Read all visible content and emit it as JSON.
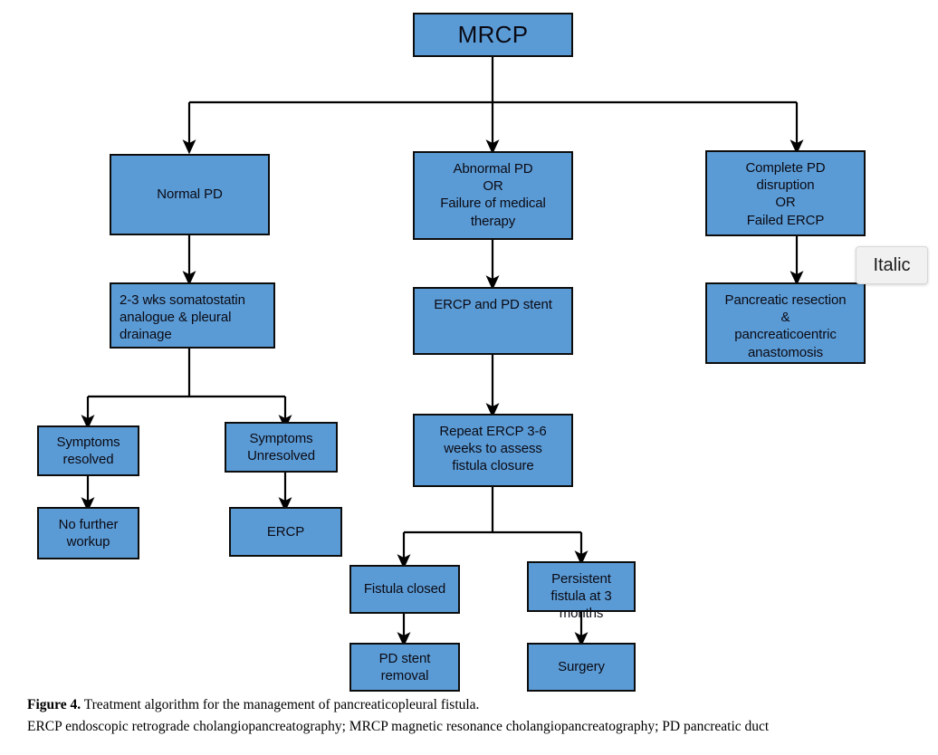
{
  "figure": {
    "caption_bold": "Figure 4.",
    "caption_rest": " Treatment algorithm for the management of pancreaticopleural fistula.",
    "abbreviations": "ERCP endoscopic retrograde cholangiopancreatography; MRCP magnetic resonance cholangiopancreatography; PD pancreatic duct"
  },
  "tooltip": {
    "label": "Italic"
  },
  "colors": {
    "node_fill": "#5B9BD5",
    "node_border": "#0d0d0d",
    "connector": "#000000",
    "tooltip_bg": "#f1f1f1",
    "page_bg": "#ffffff"
  },
  "nodes": {
    "root": "MRCP",
    "normal_pd": "Normal PD",
    "abnormal_pd": "Abnormal PD\nOR\nFailure of medical\ntherapy",
    "complete_pd": "Complete PD\ndisruption\nOR\nFailed ERCP",
    "somatostatin": "2-3 wks somatostatin\nanalogue & pleural\ndrainage",
    "ercp_pd_stent": "ERCP and PD stent",
    "pancreatic_resection": "Pancreatic resection\n&\npancreaticoentric\nanastomosis",
    "symptoms_resolved": "Symptoms\nresolved",
    "symptoms_unresolved": "Symptoms\nUnresolved",
    "no_further_workup": "No further\nworkup",
    "ercp": "ERCP",
    "repeat_ercp": "Repeat ERCP 3-6\nweeks to assess\nfistula closure",
    "fistula_closed": "Fistula closed",
    "persistent_fistula": "Persistent\nfistula at 3\nmonths",
    "pd_stent_removal": "PD stent\nremoval",
    "surgery": "Surgery"
  },
  "chart_data": {
    "type": "diagram",
    "title": "Treatment algorithm for the management of pancreaticopleural fistula",
    "diagram_kind": "flowchart",
    "orientation": "top-down",
    "node_list": [
      {
        "id": "root",
        "label": "MRCP",
        "level": 0
      },
      {
        "id": "normal_pd",
        "label": "Normal PD",
        "level": 1,
        "branch": "left"
      },
      {
        "id": "abnormal_pd",
        "label": "Abnormal PD OR Failure of medical therapy",
        "level": 1,
        "branch": "middle"
      },
      {
        "id": "complete_pd",
        "label": "Complete PD disruption OR Failed ERCP",
        "level": 1,
        "branch": "right"
      },
      {
        "id": "somatostatin",
        "label": "2-3 wks somatostatin analogue & pleural drainage",
        "level": 2,
        "branch": "left"
      },
      {
        "id": "ercp_pd_stent",
        "label": "ERCP and PD stent",
        "level": 2,
        "branch": "middle"
      },
      {
        "id": "pancreatic_resection",
        "label": "Pancreatic resection & pancreaticoentric anastomosis",
        "level": 2,
        "branch": "right"
      },
      {
        "id": "symptoms_resolved",
        "label": "Symptoms resolved",
        "level": 3,
        "branch": "left"
      },
      {
        "id": "symptoms_unresolved",
        "label": "Symptoms Unresolved",
        "level": 3,
        "branch": "left"
      },
      {
        "id": "repeat_ercp",
        "label": "Repeat ERCP 3-6 weeks to assess fistula closure",
        "level": 3,
        "branch": "middle"
      },
      {
        "id": "no_further_workup",
        "label": "No further workup",
        "level": 4,
        "branch": "left"
      },
      {
        "id": "ercp",
        "label": "ERCP",
        "level": 4,
        "branch": "left"
      },
      {
        "id": "fistula_closed",
        "label": "Fistula closed",
        "level": 4,
        "branch": "middle"
      },
      {
        "id": "persistent_fistula",
        "label": "Persistent fistula at 3 months",
        "level": 4,
        "branch": "middle"
      },
      {
        "id": "pd_stent_removal",
        "label": "PD stent removal",
        "level": 5,
        "branch": "middle"
      },
      {
        "id": "surgery",
        "label": "Surgery",
        "level": 5,
        "branch": "middle"
      }
    ],
    "edges": [
      {
        "from": "root",
        "to": "normal_pd"
      },
      {
        "from": "root",
        "to": "abnormal_pd"
      },
      {
        "from": "root",
        "to": "complete_pd"
      },
      {
        "from": "normal_pd",
        "to": "somatostatin"
      },
      {
        "from": "abnormal_pd",
        "to": "ercp_pd_stent"
      },
      {
        "from": "complete_pd",
        "to": "pancreatic_resection"
      },
      {
        "from": "somatostatin",
        "to": "symptoms_resolved"
      },
      {
        "from": "somatostatin",
        "to": "symptoms_unresolved"
      },
      {
        "from": "symptoms_resolved",
        "to": "no_further_workup"
      },
      {
        "from": "symptoms_unresolved",
        "to": "ercp"
      },
      {
        "from": "ercp_pd_stent",
        "to": "repeat_ercp"
      },
      {
        "from": "repeat_ercp",
        "to": "fistula_closed"
      },
      {
        "from": "repeat_ercp",
        "to": "persistent_fistula"
      },
      {
        "from": "fistula_closed",
        "to": "pd_stent_removal"
      },
      {
        "from": "persistent_fistula",
        "to": "surgery"
      }
    ]
  }
}
